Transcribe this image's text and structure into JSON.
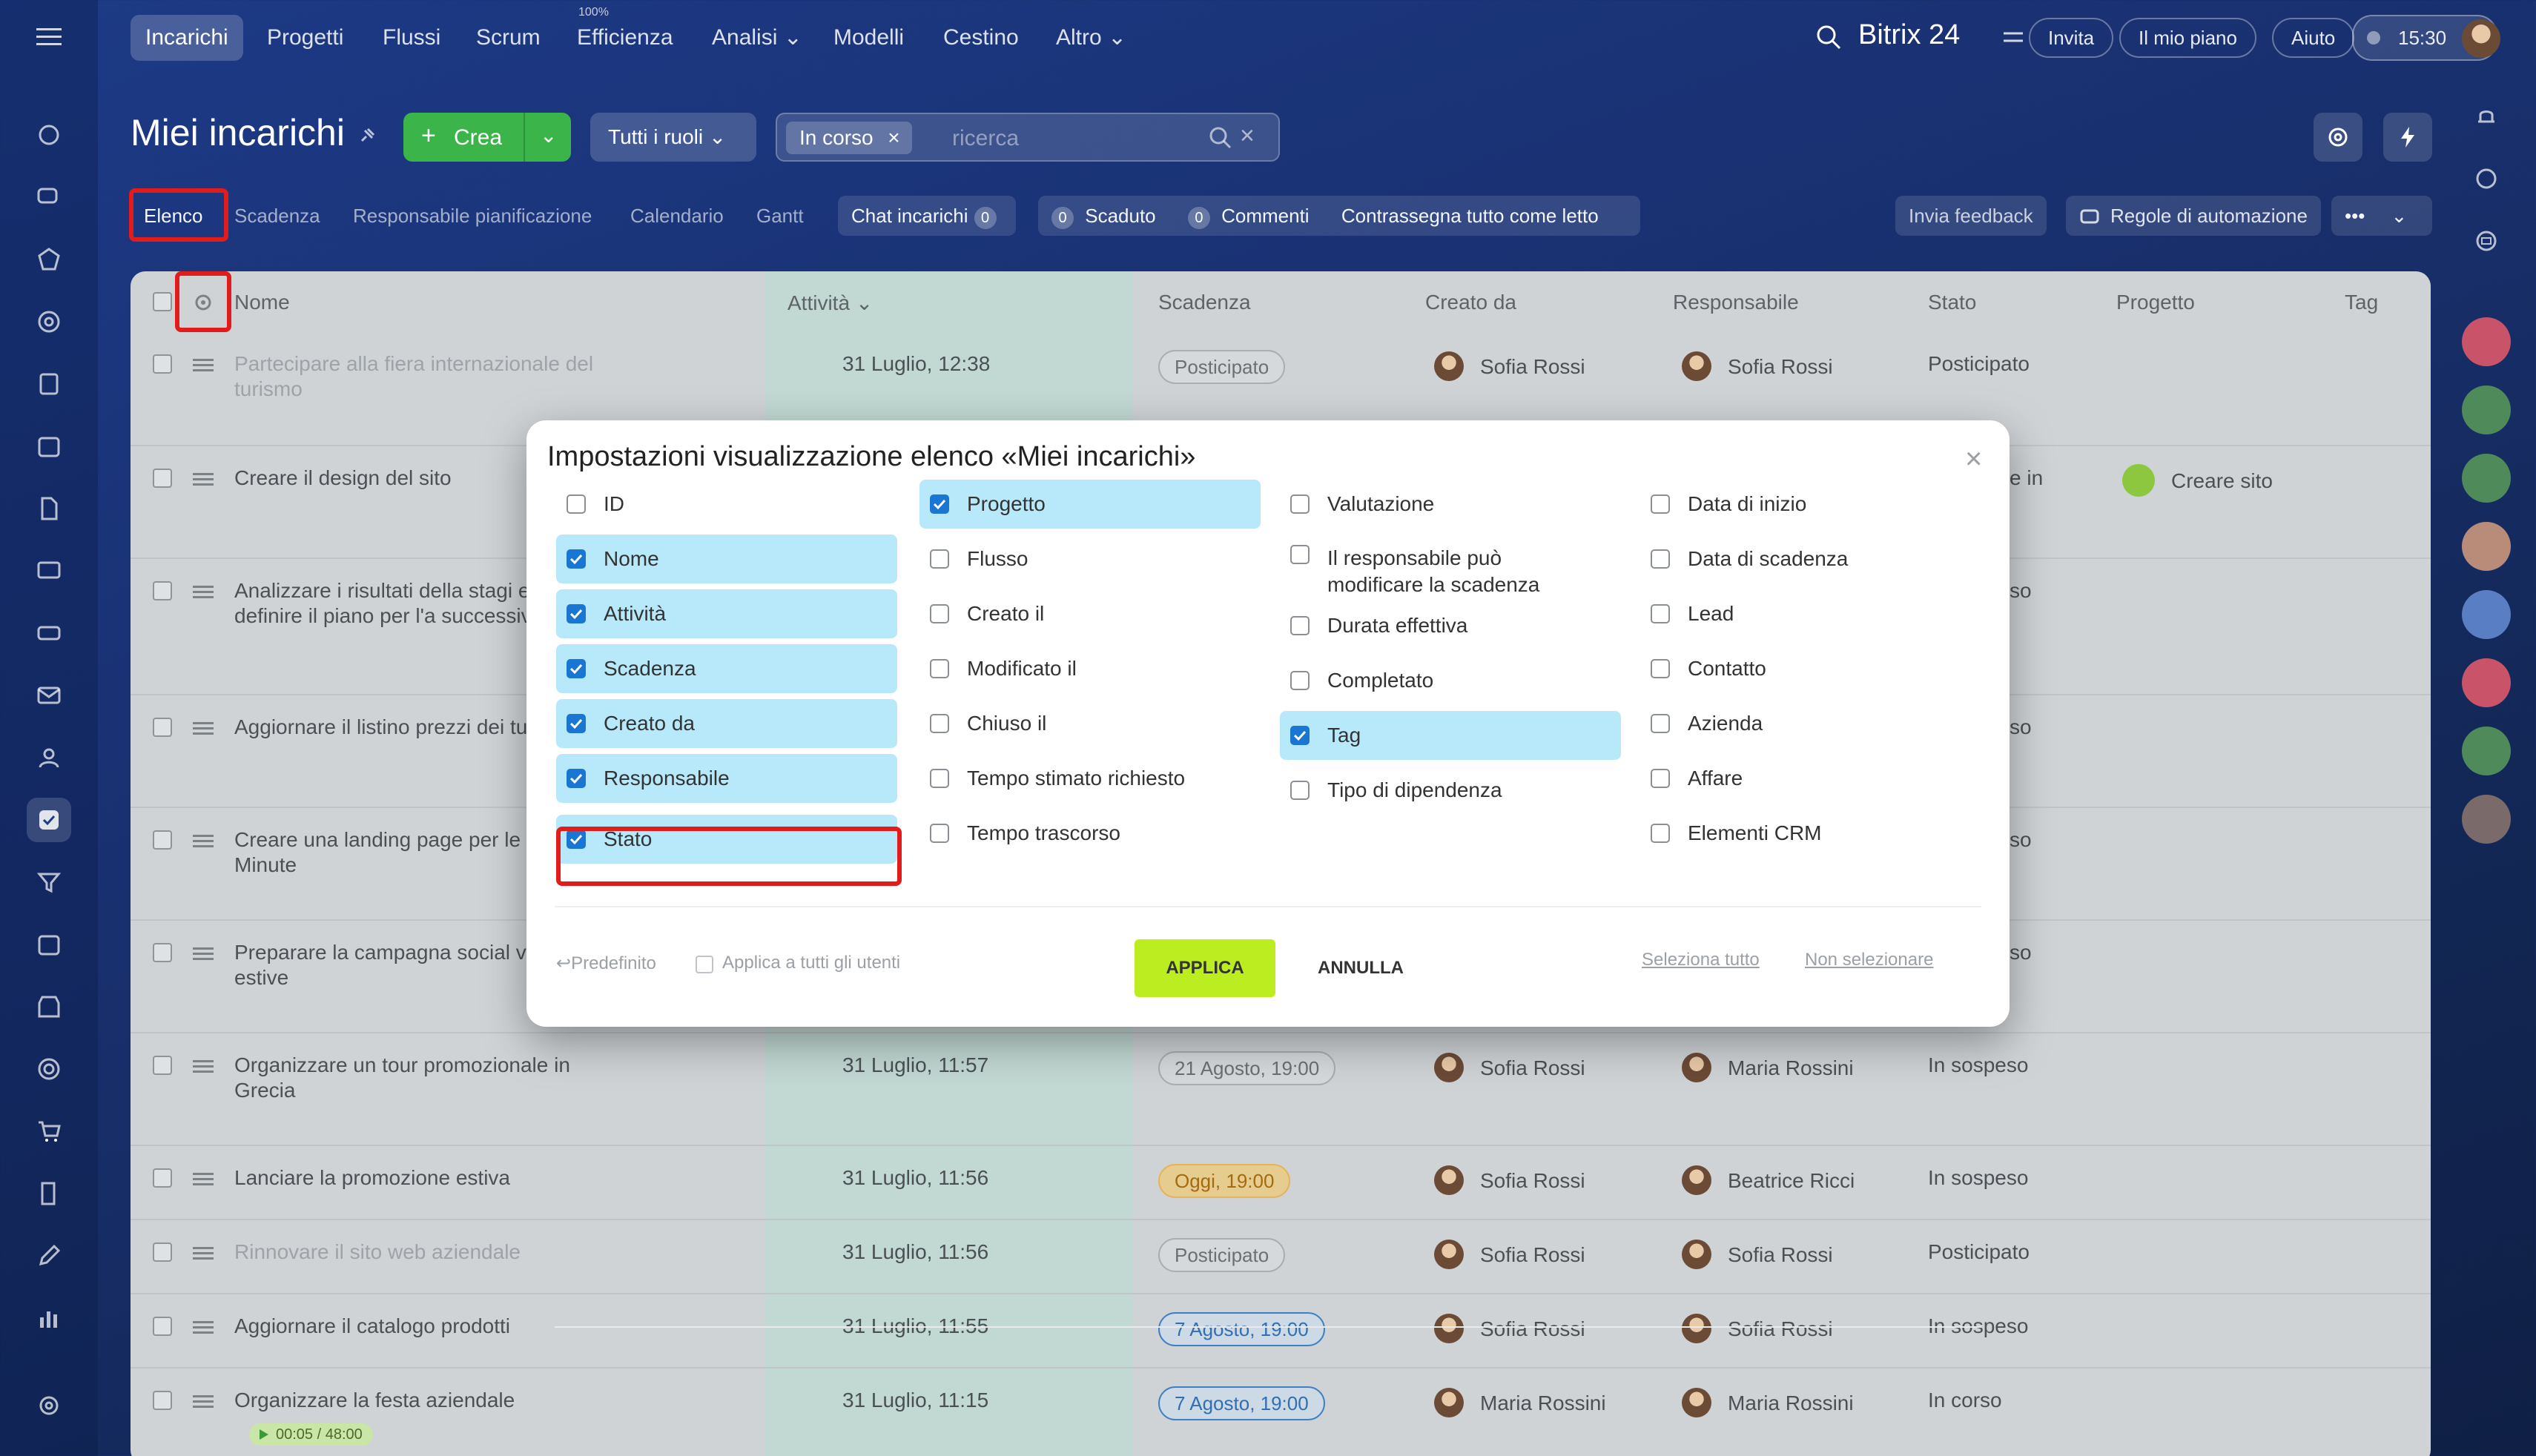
{
  "topnav": {
    "items": [
      "Incarichi",
      "Progetti",
      "Flussi",
      "Scrum",
      "Efficienza",
      "Analisi",
      "Modelli",
      "Cestino",
      "Altro"
    ],
    "efficiency_badge": "100%",
    "brand": "Bitrix 24",
    "invite": "Invita",
    "plan": "Il mio piano",
    "help": "Aiuto",
    "clock": "15:30"
  },
  "toolbar": {
    "title": "Miei incarichi",
    "create": "Crea",
    "roles": "Tutti i ruoli",
    "filter_chip": "In corso",
    "search_placeholder": "ricerca"
  },
  "subnav": {
    "views": [
      "Elenco",
      "Scadenza",
      "Responsabile pianificazione",
      "Calendario",
      "Gantt"
    ],
    "chat": "Chat incarichi",
    "chat_count": "0",
    "overdue_count": "0",
    "overdue": "Scaduto",
    "comments_count": "0",
    "comments": "Commenti",
    "mark_read": "Contrassegna tutto come letto",
    "feedback": "Invia feedback",
    "automation": "Regole di automazione",
    "more": "•••"
  },
  "table": {
    "headers": [
      "Nome",
      "Attività",
      "Scadenza",
      "Creato da",
      "Responsabile",
      "Stato",
      "Progetto",
      "Tag"
    ],
    "rows": [
      {
        "name": "Partecipare alla fiera internazionale del turismo",
        "activity": "31 Luglio, 12:38",
        "deadline": "Posticipato",
        "deadline_style": "grey",
        "created_by": "Sofia Rossi",
        "responsible": "Sofia Rossi",
        "status": "Posticipato",
        "project": "",
        "faded": true
      },
      {
        "name": "Creare il design del sito",
        "activity": "",
        "deadline": "",
        "deadline_style": "",
        "created_by": "",
        "responsible": "",
        "status": "e in",
        "project": "Creare sito",
        "faded": false
      },
      {
        "name": "Analizzare i risultati della stagi estiva e definire il piano per l'a successivo",
        "activity": "",
        "deadline": "",
        "deadline_style": "",
        "created_by": "",
        "responsible": "",
        "status": "so",
        "project": "",
        "faded": false
      },
      {
        "name": "Aggiornare il listino prezzi dei turistici",
        "activity": "",
        "deadline": "",
        "deadline_style": "",
        "created_by": "",
        "responsible": "",
        "status": "so",
        "project": "",
        "faded": false
      },
      {
        "name": "Creare una landing page per le Last Minute",
        "activity": "",
        "deadline": "",
        "deadline_style": "",
        "created_by": "",
        "responsible": "",
        "status": "so",
        "project": "",
        "faded": false
      },
      {
        "name": "Preparare la campagna social vacanze estive",
        "activity": "",
        "deadline": "",
        "deadline_style": "",
        "created_by": "",
        "responsible": "",
        "status": "so",
        "project": "",
        "faded": false
      },
      {
        "name": "Organizzare un tour promozionale in Grecia",
        "activity": "31 Luglio, 11:57",
        "deadline": "21 Agosto, 19:00",
        "deadline_style": "grey",
        "created_by": "Sofia Rossi",
        "responsible": "Maria Rossini",
        "status": "In sospeso",
        "project": "",
        "faded": false
      },
      {
        "name": "Lanciare la promozione estiva",
        "activity": "31 Luglio, 11:56",
        "deadline": "Oggi, 19:00",
        "deadline_style": "orange",
        "created_by": "Sofia Rossi",
        "responsible": "Beatrice Ricci",
        "status": "In sospeso",
        "project": "",
        "faded": false
      },
      {
        "name": "Rinnovare il sito web aziendale",
        "activity": "31 Luglio, 11:56",
        "deadline": "Posticipato",
        "deadline_style": "grey",
        "created_by": "Sofia Rossi",
        "responsible": "Sofia Rossi",
        "status": "Posticipato",
        "project": "",
        "faded": true
      },
      {
        "name": "Aggiornare il catalogo prodotti",
        "activity": "31 Luglio, 11:55",
        "deadline": "7 Agosto, 19:00",
        "deadline_style": "blue",
        "created_by": "Sofia Rossi",
        "responsible": "Sofia Rossi",
        "status": "In sospeso",
        "project": "",
        "faded": false
      },
      {
        "name": "Organizzare la festa aziendale",
        "activity": "31 Luglio, 11:15",
        "deadline": "7 Agosto, 19:00",
        "deadline_style": "blue",
        "created_by": "Maria Rossini",
        "responsible": "Maria Rossini",
        "status": "In corso",
        "project": "",
        "faded": false,
        "timer": "00:05 / 48:00"
      }
    ]
  },
  "modal": {
    "title": "Impostazioni visualizzazione elenco «Miei incarichi»",
    "columns": [
      [
        {
          "label": "ID",
          "checked": false
        },
        {
          "label": "Nome",
          "checked": true
        },
        {
          "label": "Attività",
          "checked": true
        },
        {
          "label": "Scadenza",
          "checked": true
        },
        {
          "label": "Creato da",
          "checked": true
        },
        {
          "label": "Responsabile",
          "checked": true
        },
        {
          "label": "Stato",
          "checked": true
        }
      ],
      [
        {
          "label": "Progetto",
          "checked": true
        },
        {
          "label": "Flusso",
          "checked": false
        },
        {
          "label": "Creato il",
          "checked": false
        },
        {
          "label": "Modificato il",
          "checked": false
        },
        {
          "label": "Chiuso il",
          "checked": false
        },
        {
          "label": "Tempo stimato richiesto",
          "checked": false
        },
        {
          "label": "Tempo trascorso",
          "checked": false
        }
      ],
      [
        {
          "label": "Valutazione",
          "checked": false
        },
        {
          "label": "Il responsabile può modificare la scadenza",
          "checked": false
        },
        {
          "label": "Durata effettiva",
          "checked": false
        },
        {
          "label": "Completato",
          "checked": false
        },
        {
          "label": "Tag",
          "checked": true
        },
        {
          "label": "Tipo di dipendenza",
          "checked": false
        }
      ],
      [
        {
          "label": "Data di inizio",
          "checked": false
        },
        {
          "label": "Data di scadenza",
          "checked": false
        },
        {
          "label": "Lead",
          "checked": false
        },
        {
          "label": "Contatto",
          "checked": false
        },
        {
          "label": "Azienda",
          "checked": false
        },
        {
          "label": "Affare",
          "checked": false
        },
        {
          "label": "Elementi CRM",
          "checked": false
        }
      ]
    ],
    "default_label": "Predefinito",
    "apply_all": "Applica a tutti gli utenti",
    "apply": "APPLICA",
    "cancel": "ANNULLA",
    "select_all": "Seleziona tutto",
    "select_none": "Non selezionare"
  },
  "colors": {
    "highlight_red": "#e21b1b",
    "checked_bg": "#b7e9fb",
    "checkbox_blue": "#1976d2",
    "apply_green": "#bbed21",
    "create_green": "#3bb54a"
  }
}
